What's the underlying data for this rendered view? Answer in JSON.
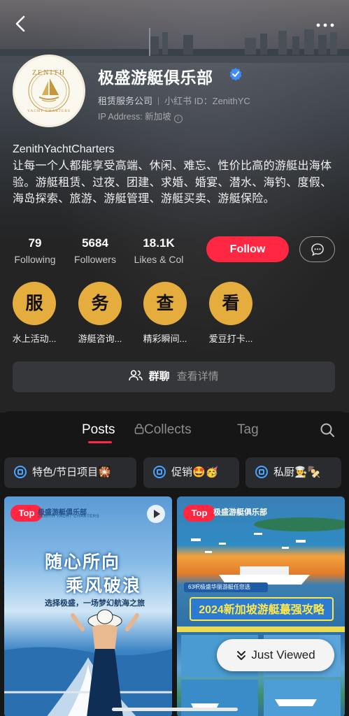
{
  "profile": {
    "name": "极盛游艇俱乐部",
    "category": "租赁服务公司",
    "id_label": "小红书 ID：ZenithYC",
    "ip_label": "IP Address: 新加坡",
    "handle": "ZenithYachtCharters",
    "bio": "让每一个人都能享受高端、休闲、难忘、性价比高的游艇出海体验。游艇租赁、过夜、团建、求婚、婚宴、潜水、海钓、度假、海岛探索、旅游、游艇管理、游艇买卖、游艇保险。",
    "avatar_text_top": "ZENITH",
    "avatar_text_bottom": "YACHT CHARTERS"
  },
  "stats": [
    {
      "value": "79",
      "label": "Following"
    },
    {
      "value": "5684",
      "label": "Followers"
    },
    {
      "value": "18.1K",
      "label": "Likes & Col"
    }
  ],
  "actions": {
    "follow_label": "Follow"
  },
  "services": [
    {
      "char": "服",
      "caption": "水上活动..."
    },
    {
      "char": "务",
      "caption": "游艇咨询..."
    },
    {
      "char": "查",
      "caption": "精彩瞬间..."
    },
    {
      "char": "看",
      "caption": "爱豆打卡..."
    }
  ],
  "group": {
    "title": "群聊",
    "detail": "查看详情"
  },
  "tabs": [
    {
      "label": "Posts"
    },
    {
      "label": "Collects"
    },
    {
      "label": "Tag"
    }
  ],
  "chips": [
    {
      "label": "特色/节日项目🎇"
    },
    {
      "label": "促销🤩🥳"
    },
    {
      "label": "私厨👨‍🍳🍢"
    }
  ],
  "cards": [
    {
      "badge": "Top",
      "brand": "极盛游艇俱乐部",
      "brand_sub": "ZENITH YACHT CHARTERS",
      "headline_1": "随心所向",
      "headline_2": "乘风破浪",
      "tagline": "选择极盛，一场梦幻航海之旅"
    },
    {
      "badge": "Top",
      "brand": "极盛游艇俱乐部",
      "strip": "63呎极盛华丽游艇任您选",
      "title": "2024新加坡游艇蕞强攻略"
    }
  ],
  "just_viewed": "Just Viewed",
  "colors": {
    "accent": "#ff2741",
    "gold": "#e5ad3e",
    "verified": "#3f8cff"
  }
}
